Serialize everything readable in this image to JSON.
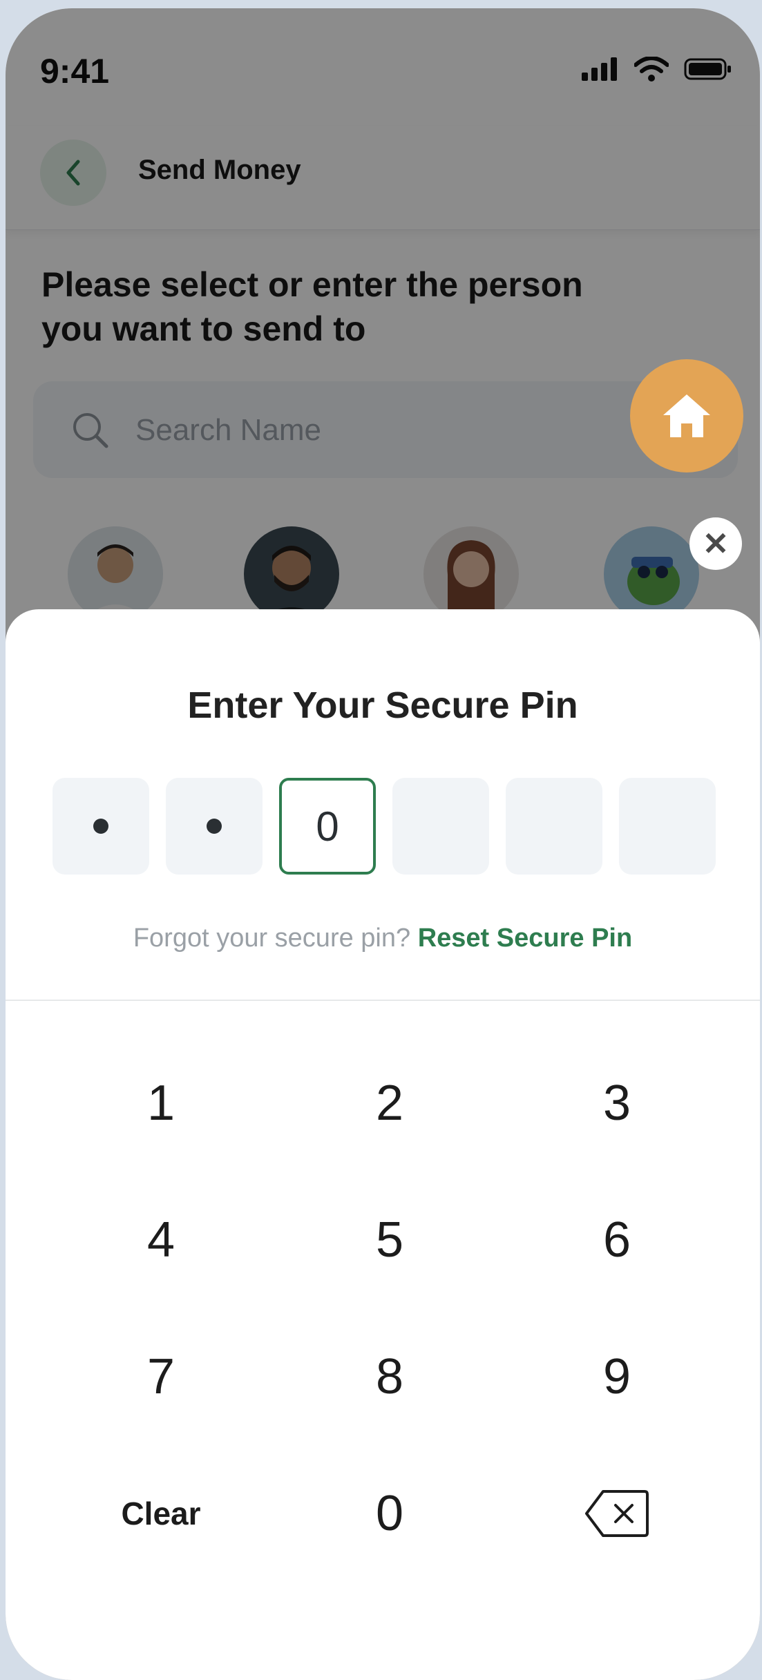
{
  "status_bar": {
    "time": "9:41"
  },
  "header": {
    "title": "Send Money"
  },
  "main": {
    "prompt": "Please select or enter the person you want to send to",
    "search_placeholder": "Search Name"
  },
  "sheet": {
    "title": "Enter Your Secure Pin",
    "pin": [
      {
        "state": "dot",
        "value": ""
      },
      {
        "state": "dot",
        "value": ""
      },
      {
        "state": "active",
        "value": "0"
      },
      {
        "state": "empty",
        "value": ""
      },
      {
        "state": "empty",
        "value": ""
      },
      {
        "state": "empty",
        "value": ""
      }
    ],
    "forgot_text": "Forgot your secure pin?",
    "reset_link": "Reset Secure Pin"
  },
  "keypad": {
    "k1": "1",
    "k2": "2",
    "k3": "3",
    "k4": "4",
    "k5": "5",
    "k6": "6",
    "k7": "7",
    "k8": "8",
    "k9": "9",
    "clear": "Clear",
    "k0": "0"
  },
  "colors": {
    "accent": "#2e7d4f",
    "home_fab": "#e3a455",
    "back_bg": "#e6f2ea"
  }
}
